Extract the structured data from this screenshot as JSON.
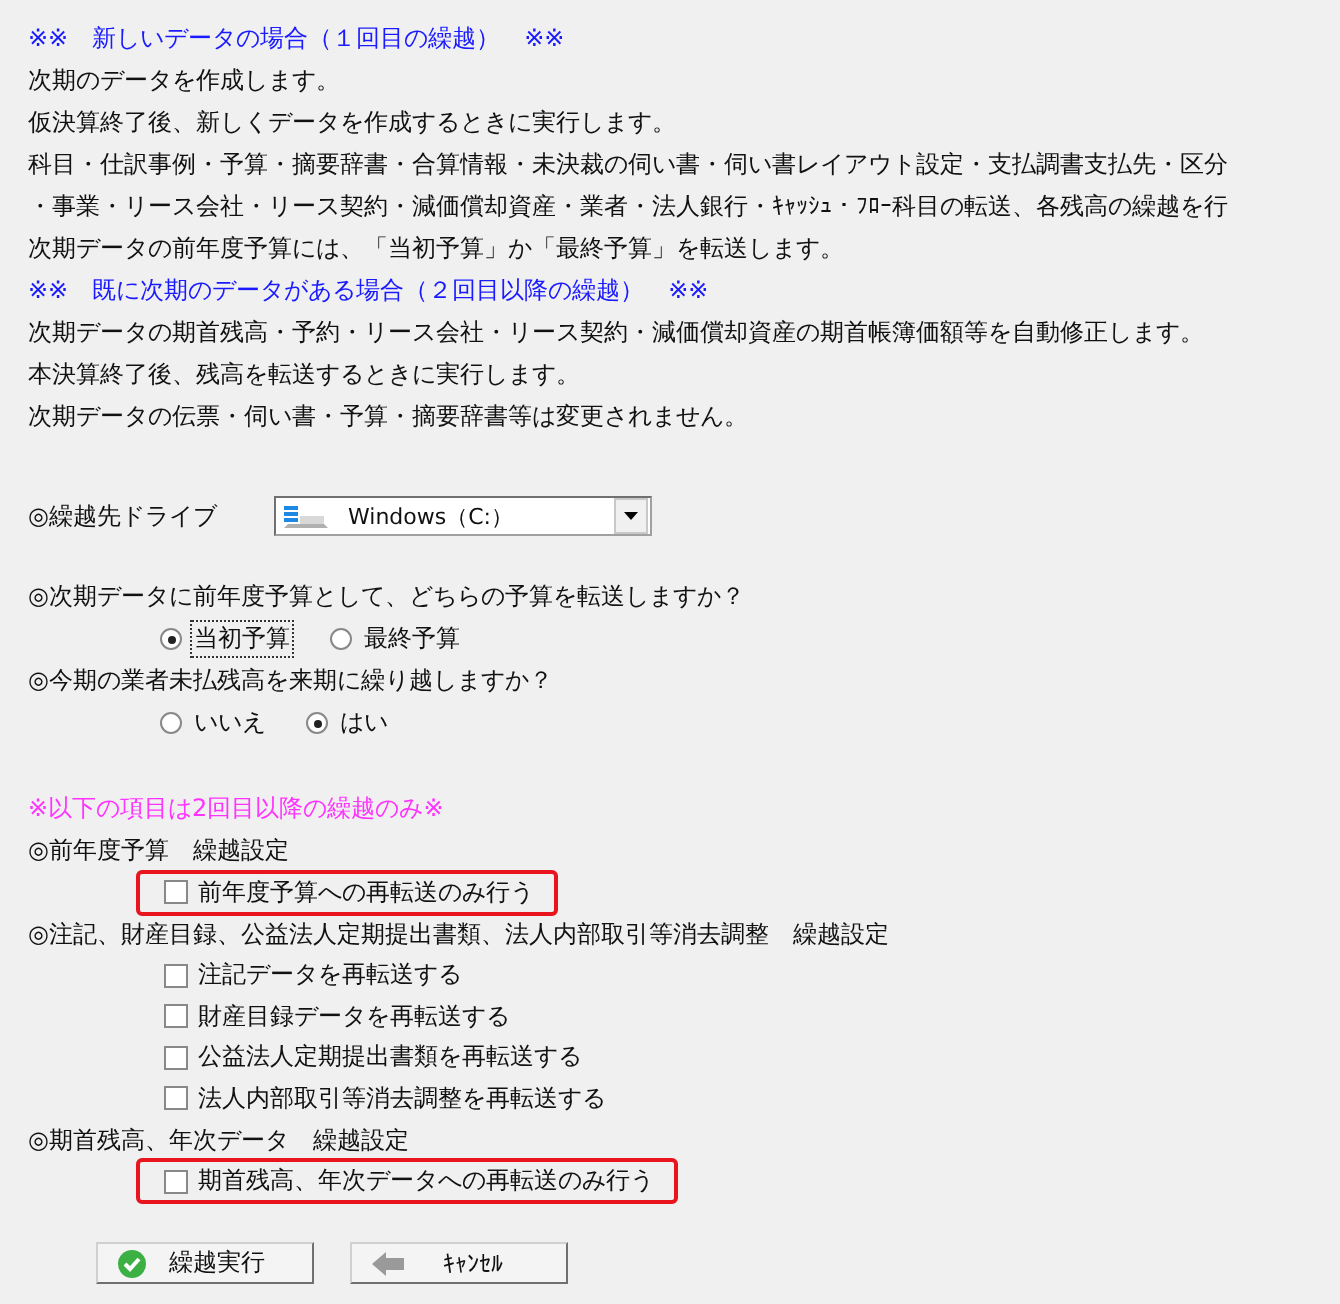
{
  "intro": [
    {
      "kind": "heading",
      "text": "※※　新しいデータの場合（１回目の繰越）　※※"
    },
    {
      "kind": "text",
      "text": "次期のデータを作成します。"
    },
    {
      "kind": "text",
      "text": "仮決算終了後、新しくデータを作成するときに実行します。"
    },
    {
      "kind": "text",
      "text": "科目・仕訳事例・予算・摘要辞書・合算情報・未決裁の伺い書・伺い書レイアウト設定・支払調書支払先・区分"
    },
    {
      "kind": "text",
      "text": "・事業・リース会社・リース契約・減価償却資産・業者・法人銀行・ｷｬｯｼｭ・ﾌﾛｰ科目の転送、各残高の繰越を行"
    },
    {
      "kind": "text",
      "text": "次期データの前年度予算には、「当初予算」か「最終予算」を転送します。"
    },
    {
      "kind": "heading",
      "text": "※※　既に次期のデータがある場合（２回目以降の繰越）　※※"
    },
    {
      "kind": "text",
      "text": "次期データの期首残高・予約・リース会社・リース契約・減価償却資産の期首帳簿価額等を自動修正します。"
    },
    {
      "kind": "text",
      "text": "本決算終了後、残高を転送するときに実行します。"
    },
    {
      "kind": "text",
      "text": "次期データの伝票・伺い書・予算・摘要辞書等は変更されません。"
    }
  ],
  "drive": {
    "label": "◎繰越先ドライブ",
    "value": "Windows（C:）"
  },
  "questions": [
    {
      "label": "◎次期データに前年度予算として、どちらの予算を転送しますか？",
      "options": [
        {
          "label": "当初予算",
          "selected": true,
          "focused": true
        },
        {
          "label": "最終予算",
          "selected": false,
          "focused": false
        }
      ]
    },
    {
      "label": "◎今期の業者未払残高を来期に繰り越しますか？",
      "options": [
        {
          "label": "いいえ",
          "selected": false,
          "focused": false
        },
        {
          "label": "はい",
          "selected": true,
          "focused": false
        }
      ]
    }
  ],
  "note": "※以下の項目は2回目以降の繰越のみ※",
  "sections": [
    {
      "label": "◎前年度予算　繰越設定",
      "options": [
        {
          "label": "前年度予算への再転送のみ行う",
          "checked": false,
          "highlighted": true
        }
      ]
    },
    {
      "label": "◎注記、財産目録、公益法人定期提出書類、法人内部取引等消去調整　繰越設定",
      "options": [
        {
          "label": "注記データを再転送する",
          "checked": false,
          "highlighted": false
        },
        {
          "label": "財産目録データを再転送する",
          "checked": false,
          "highlighted": false
        },
        {
          "label": "公益法人定期提出書類を再転送する",
          "checked": false,
          "highlighted": false
        },
        {
          "label": "法人内部取引等消去調整を再転送する",
          "checked": false,
          "highlighted": false
        }
      ]
    },
    {
      "label": "◎期首残高、年次データ　繰越設定",
      "options": [
        {
          "label": "期首残高、年次データへの再転送のみ行う",
          "checked": false,
          "highlighted": true
        }
      ]
    }
  ],
  "buttons": [
    {
      "kind": "ok",
      "label": "繰越実行"
    },
    {
      "kind": "back",
      "label": "ｷｬﾝｾﾙ"
    }
  ]
}
